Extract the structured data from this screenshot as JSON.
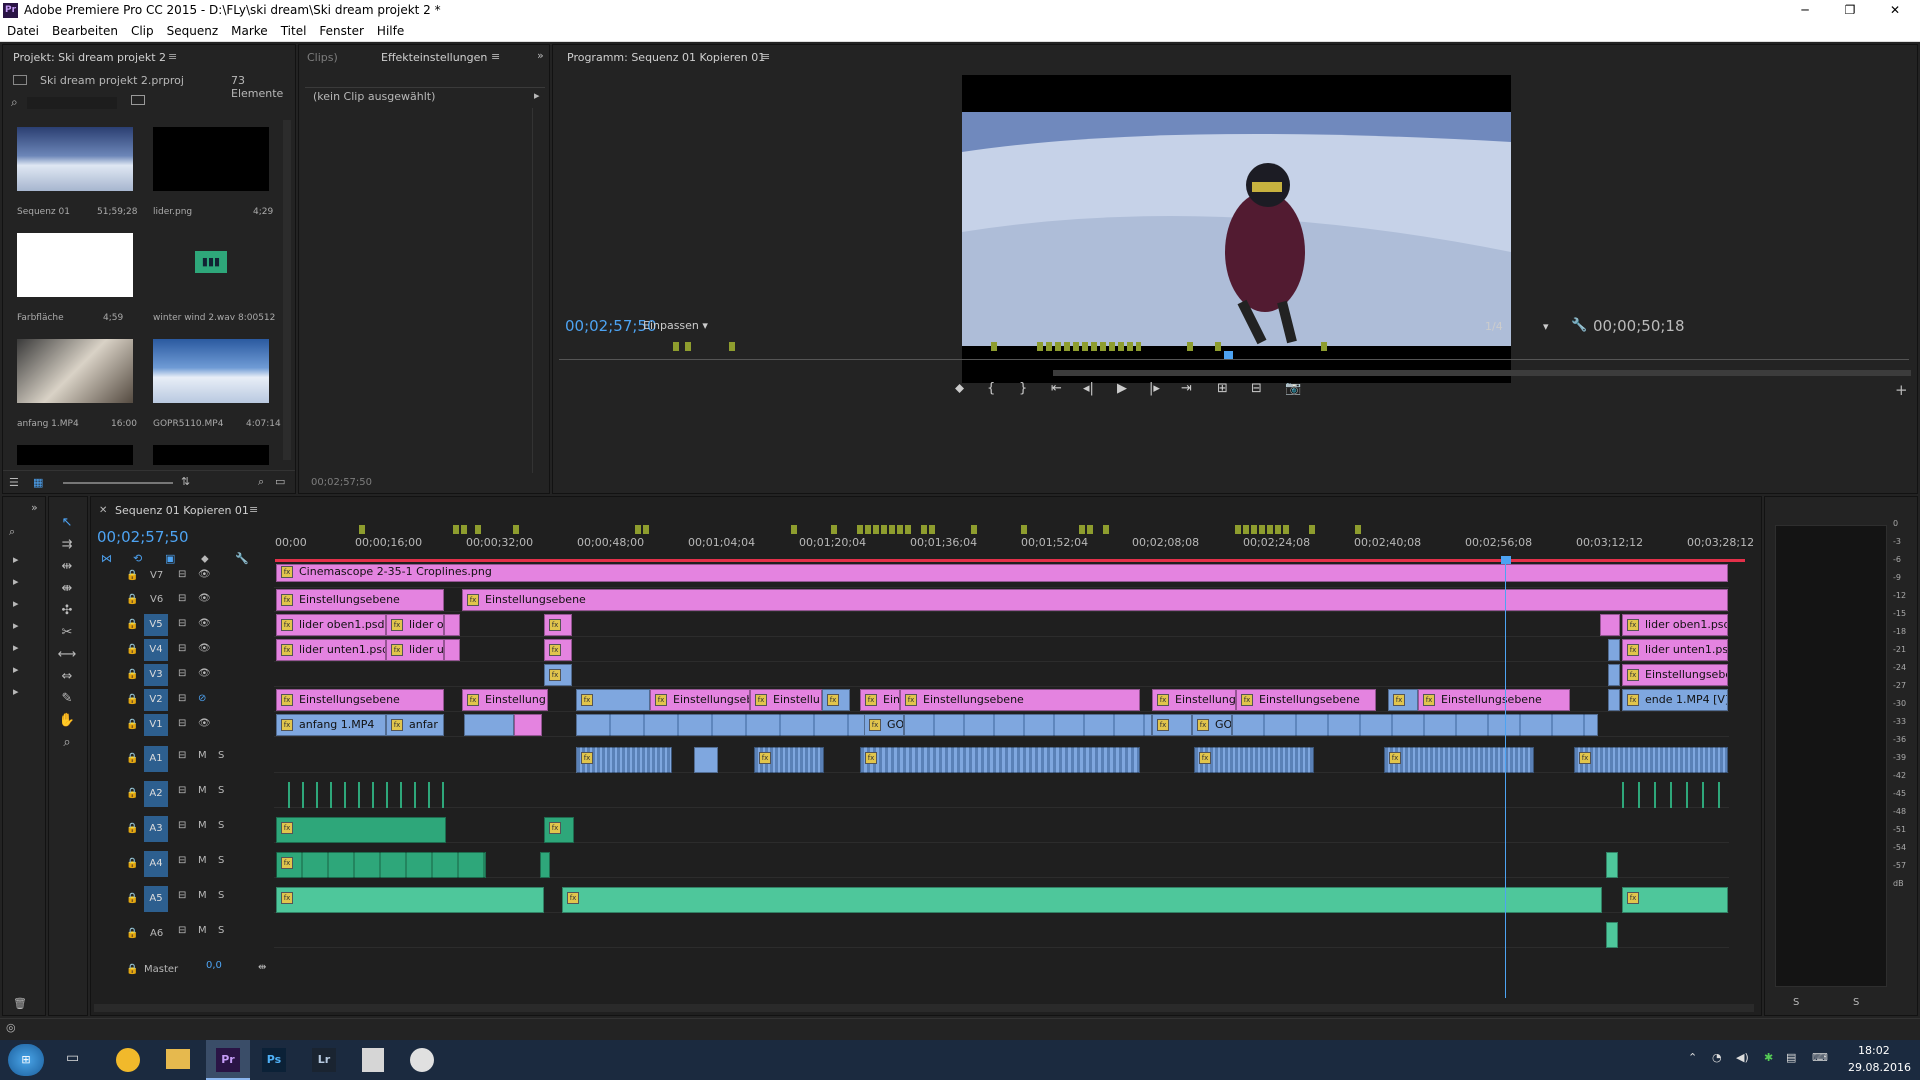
{
  "window": {
    "title": "Adobe Premiere Pro CC 2015 - D:\\FLy\\ski dream\\Ski dream projekt 2 *"
  },
  "menu": [
    "Datei",
    "Bearbeiten",
    "Clip",
    "Sequenz",
    "Marke",
    "Titel",
    "Fenster",
    "Hilfe"
  ],
  "project": {
    "tab": "Projekt: Ski dream projekt 2",
    "file": "Ski dream projekt 2.prproj",
    "count": "73 Elemente",
    "items": [
      {
        "name": "Sequenz 01",
        "dur": "51;59;28"
      },
      {
        "name": "lider.png",
        "dur": "4;29"
      },
      {
        "name": "Farbfläche",
        "dur": "4;59"
      },
      {
        "name": "winter wind 2.wav",
        "dur": "8:00512"
      },
      {
        "name": "anfang 1.MP4",
        "dur": "16:00"
      },
      {
        "name": "GOPR5110.MP4",
        "dur": "4:07:14"
      }
    ]
  },
  "effects": {
    "tab_clips": "Clips)",
    "tab": "Effekteinstellungen",
    "no_clip": "(kein Clip ausgewählt)",
    "timecode": "00;02;57;50"
  },
  "program": {
    "tab": "Programm: Sequenz 01 Kopieren 01",
    "timecode": "00;02;57;50",
    "fit": "Einpassen",
    "res": "1/4",
    "duration": "00;00;50;18"
  },
  "timeline": {
    "tab": "Sequenz 01 Kopieren 01",
    "timecode": "00;02;57;50",
    "ruler": [
      "00;00",
      "00;00;16;00",
      "00;00;32;00",
      "00;00;48;00",
      "00;01;04;04",
      "00;01;20;04",
      "00;01;36;04",
      "00;01;52;04",
      "00;02;08;08",
      "00;02;24;08",
      "00;02;40;08",
      "00;02;56;08",
      "00;03;12;12",
      "00;03;28;12"
    ],
    "video_tracks": [
      "V7",
      "V6",
      "V5",
      "V4",
      "V3",
      "V2",
      "V1"
    ],
    "audio_tracks": [
      "A1",
      "A2",
      "A3",
      "A4",
      "A5",
      "A6"
    ],
    "master": "Master",
    "master_val": "0,0",
    "clips": {
      "v7": "Cinemascope 2-35-1 Croplines.png",
      "v6a": "Einstellungsebene",
      "v6b": "Einstellungsebene",
      "v5a": "lider oben1.psd",
      "v5b": "lider o",
      "v5c": "lider oben1.psd",
      "v4a": "lider unten1.psd",
      "v4b": "lider u",
      "v4c": "lider unten1.psd",
      "v3c": "Einstellungsebe",
      "v2a": "Einstellungsebene",
      "v2b": "Einstellung",
      "v2c": "Einstellungseb",
      "v2d": "Einstellu",
      "v2e": "Eins",
      "v2f": "Einstellungsebene",
      "v2g": "Einstellung",
      "v2h": "Einstellungsebene",
      "v2i": "Einstellungsebene",
      "v2j": "ende 1.MP4 [V]",
      "v1a": "anfang 1.MP4",
      "v1b": "anfar",
      "v1c": "GOF",
      "v1d": "GOF"
    }
  },
  "meter": {
    "labels": [
      "0",
      "-3",
      "-6",
      "-9",
      "-12",
      "-15",
      "-18",
      "-21",
      "-24",
      "-27",
      "-30",
      "-33",
      "-36",
      "-39",
      "-42",
      "-45",
      "-48",
      "-51",
      "-54",
      "-57",
      "dB"
    ],
    "s": "S"
  },
  "taskbar": {
    "time": "18:02",
    "date": "29.08.2016"
  }
}
